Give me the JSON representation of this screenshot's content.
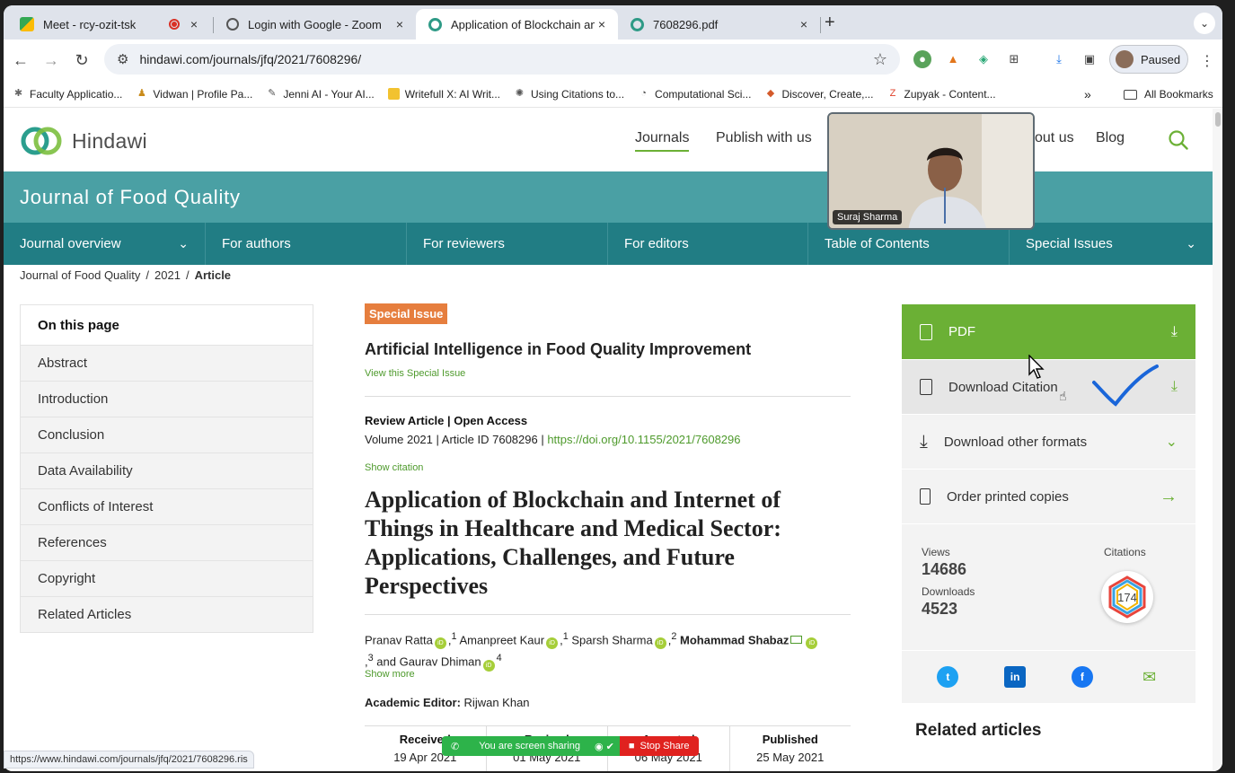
{
  "browser": {
    "tabs": [
      {
        "title": "Meet - rcy-ozit-tsk",
        "close": "×"
      },
      {
        "title": "Login with Google - Zoom",
        "close": "×"
      },
      {
        "title": "Application of Blockchain and",
        "close": "×"
      },
      {
        "title": "7608296.pdf",
        "close": "×"
      }
    ],
    "new_tab": "+",
    "url": "hindawi.com/journals/jfq/2021/7608296/",
    "profile_label": "Paused",
    "bookmarks": [
      "Faculty Applicatio...",
      "Vidwan | Profile Pa...",
      "Jenni AI - Your AI...",
      "Writefull X: AI Writ...",
      "Using Citations to...",
      "Computational Sci...",
      "Discover, Create,...",
      "Zupyak - Content..."
    ],
    "bookmarks_more": "»",
    "all_bookmarks": "All Bookmarks",
    "status_url": "https://www.hindawi.com/journals/jfq/2021/7608296.ris"
  },
  "site": {
    "logo_text": "Hindawi",
    "nav": [
      "Journals",
      "Publish with us",
      "out us",
      "Blog"
    ],
    "journal_title": "Journal of Food Quality",
    "subnav": [
      "Journal overview",
      "For authors",
      "For reviewers",
      "For editors",
      "Table of Contents",
      "Special Issues"
    ],
    "breadcrumb": [
      "Journal of Food Quality",
      "2021",
      "Article"
    ],
    "breadcrumb_sep": "/"
  },
  "toc": {
    "heading": "On this page",
    "items": [
      "Abstract",
      "Introduction",
      "Conclusion",
      "Data Availability",
      "Conflicts of Interest",
      "References",
      "Copyright",
      "Related Articles"
    ]
  },
  "article": {
    "badge": "Special Issue",
    "special_issue_title": "Artificial Intelligence in Food Quality Improvement",
    "view_special_issue": "View this Special Issue",
    "type_line": "Review Article | Open Access",
    "meta_prefix": "Volume 2021 | Article ID 7608296 | ",
    "doi": "https://doi.org/10.1155/2021/7608296",
    "show_citation": "Show citation",
    "title": "Application of Blockchain and Internet of Things in Healthcare and Medical Sector: Applications, Challenges, and Future Perspectives",
    "authors": [
      {
        "name": "Pranav Ratta",
        "sup": "1"
      },
      {
        "name": "Amanpreet Kaur",
        "sup": "1"
      },
      {
        "name": "Sparsh Sharma",
        "sup": "2"
      },
      {
        "name": "Mohammad Shabaz",
        "sup": "3"
      },
      {
        "name": "and Gaurav Dhiman",
        "sup": "4"
      }
    ],
    "show_more": "Show more",
    "editor_label": "Academic Editor:",
    "editor_name": "Rijwan Khan",
    "dates": [
      {
        "label": "Received",
        "value": "19 Apr 2021"
      },
      {
        "label": "Revised",
        "value": "01 May 2021"
      },
      {
        "label": "Accepted",
        "value": "06 May 2021"
      },
      {
        "label": "Published",
        "value": "25 May 2021"
      }
    ]
  },
  "sidebar": {
    "pdf": "PDF",
    "download_citation": "Download Citation",
    "download_other": "Download other formats",
    "order_printed": "Order printed copies",
    "views_label": "Views",
    "views": "14686",
    "downloads_label": "Downloads",
    "downloads": "4523",
    "citations_label": "Citations",
    "citations": "174",
    "related_heading": "Related articles"
  },
  "video": {
    "participant": "Suraj Sharma"
  },
  "share_bar": {
    "status": "You are screen sharing",
    "stop": "Stop Share"
  },
  "colors": {
    "brand_green": "#6bb035",
    "teal": "#4aa0a4",
    "teal_dark": "#217d84",
    "badge_orange": "#e67e3e"
  }
}
